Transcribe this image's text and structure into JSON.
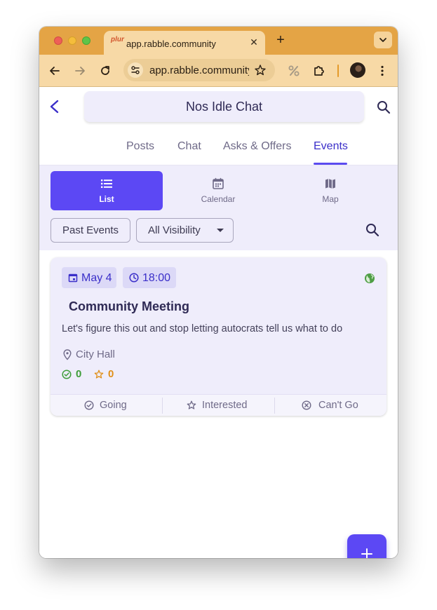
{
  "browser": {
    "tab_title": "app.rabble.community",
    "favicon_text": "plur",
    "url": "app.rabble.community",
    "icons": [
      "back-arrow-icon",
      "forward-arrow-icon",
      "reload-icon",
      "site-settings-icon",
      "bookmark-star-icon",
      "extension-percent-icon",
      "extensions-puzzle-icon",
      "profile-avatar",
      "more-vert-icon"
    ]
  },
  "header": {
    "title": "Nos Idle Chat"
  },
  "tabs": [
    {
      "label": "Posts"
    },
    {
      "label": "Chat"
    },
    {
      "label": "Asks & Offers"
    },
    {
      "label": "Events"
    }
  ],
  "active_tab": "Events",
  "view_modes": [
    {
      "label": "List",
      "icon": "list-icon"
    },
    {
      "label": "Calendar",
      "icon": "calendar-icon"
    },
    {
      "label": "Map",
      "icon": "map-icon"
    }
  ],
  "active_view": "List",
  "filters": {
    "past_events": "Past Events",
    "visibility": "All Visibility"
  },
  "event": {
    "date": "May 4",
    "time": "18:00",
    "title": "Community Meeting",
    "description": "Let's figure this out and stop letting autocrats tell us what to do",
    "location": "City Hall",
    "going_count": "0",
    "interested_count": "0",
    "visibility_icon": "globe-icon"
  },
  "actions": {
    "going": "Going",
    "interested": "Interested",
    "cant_go": "Can't Go"
  },
  "colors": {
    "accent": "#5c48f4",
    "accent_text": "#3b2fc9",
    "panel_bg": "#efedfb",
    "browser_frame": "#e4a445",
    "going_green": "#3f9d3a",
    "interested_orange": "#e0901a"
  }
}
